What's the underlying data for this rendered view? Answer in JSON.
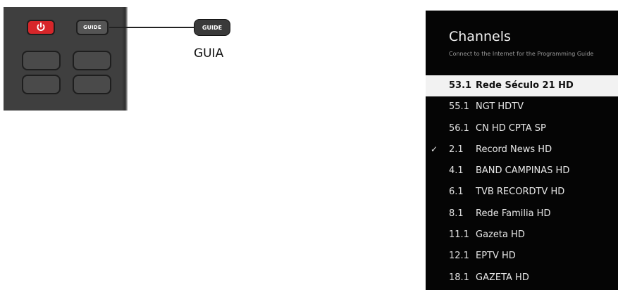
{
  "remote": {
    "guide_button_label": "GUIDE",
    "power_color": "#d7262a"
  },
  "callout": {
    "button_label": "GUIDE",
    "caption": "GUIA"
  },
  "panel": {
    "title": "Channels",
    "subtitle": "Connect to the Internet for the Programming Guide",
    "channels": [
      {
        "number": "53.1",
        "name": "Rede Século 21 HD",
        "selected": true,
        "checked": false
      },
      {
        "number": "55.1",
        "name": "NGT HDTV",
        "selected": false,
        "checked": false
      },
      {
        "number": "56.1",
        "name": "CN HD CPTA SP",
        "selected": false,
        "checked": false
      },
      {
        "number": "2.1",
        "name": "Record News HD",
        "selected": false,
        "checked": true
      },
      {
        "number": "4.1",
        "name": "BAND CAMPINAS HD",
        "selected": false,
        "checked": false
      },
      {
        "number": "6.1",
        "name": "TVB RECORDTV HD",
        "selected": false,
        "checked": false
      },
      {
        "number": "8.1",
        "name": "Rede Familia HD",
        "selected": false,
        "checked": false
      },
      {
        "number": "11.1",
        "name": "Gazeta HD",
        "selected": false,
        "checked": false
      },
      {
        "number": "12.1",
        "name": "EPTV HD",
        "selected": false,
        "checked": false
      },
      {
        "number": "18.1",
        "name": "GAZETA HD",
        "selected": false,
        "checked": false
      }
    ],
    "check_glyph": "✓"
  }
}
